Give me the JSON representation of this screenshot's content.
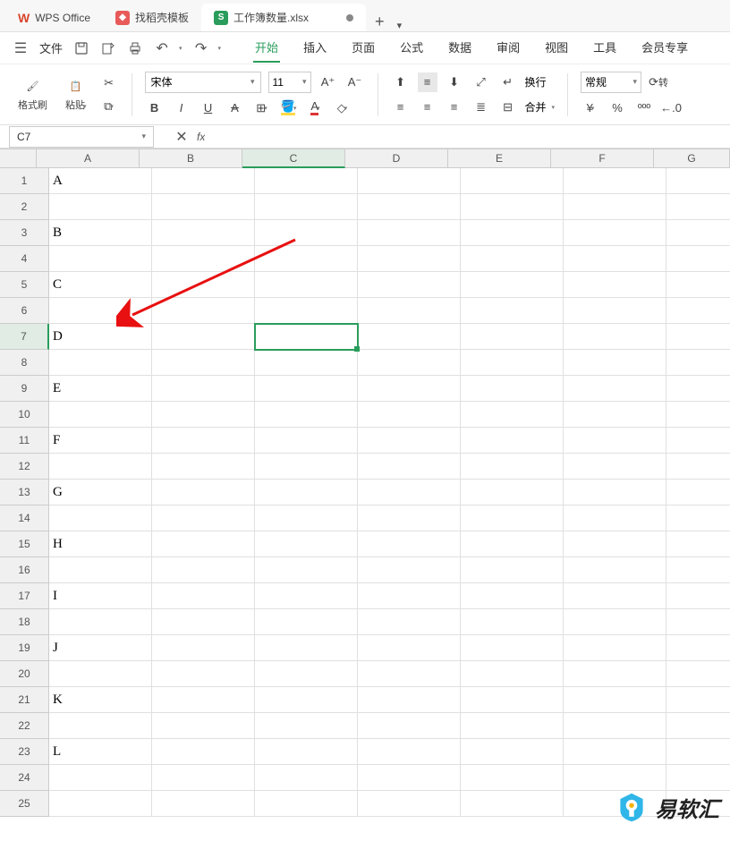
{
  "titleTabs": {
    "wps": "WPS Office",
    "dao": "找稻壳模板",
    "xls": "工作簿数量.xlsx"
  },
  "menu": {
    "file": "文件",
    "tabs": [
      "开始",
      "插入",
      "页面",
      "公式",
      "数据",
      "审阅",
      "视图",
      "工具",
      "会员专享"
    ],
    "activeTab": "开始"
  },
  "ribbon": {
    "formatBrush": "格式刷",
    "paste": "粘贴",
    "font": "宋体",
    "fontSize": "11",
    "wrap": "换行",
    "merge": "合并",
    "numberFormat": "常规",
    "rotate": "转"
  },
  "nameBox": "C7",
  "selectedCell": {
    "row": 7,
    "col": "C"
  },
  "columns": [
    "A",
    "B",
    "C",
    "D",
    "E",
    "F",
    "G"
  ],
  "colWidths": [
    "col-w-a",
    "col-w-b",
    "col-w-c",
    "col-w-d",
    "col-w-e",
    "col-w-f",
    "col-w-g"
  ],
  "rows": [
    1,
    2,
    3,
    4,
    5,
    6,
    7,
    8,
    9,
    10,
    11,
    12,
    13,
    14,
    15,
    16,
    17,
    18,
    19,
    20,
    21,
    22,
    23,
    24,
    25
  ],
  "cells": {
    "A1": "A",
    "A3": "B",
    "A5": "C",
    "A7": "D",
    "A9": "E",
    "A11": "F",
    "A13": "G",
    "A15": "H",
    "A17": "I",
    "A19": "J",
    "A21": "K",
    "A23": "L"
  },
  "watermark": "易软汇"
}
